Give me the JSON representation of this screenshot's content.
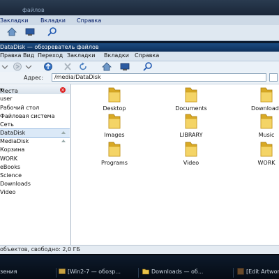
{
  "background_window": {
    "title": "файлов",
    "menu": [
      "Закладки",
      "Вкладки",
      "Справка"
    ]
  },
  "window": {
    "title": "DataDisk — обозреватель файлов",
    "menu": [
      "Правка",
      "Вид",
      "Переход",
      "Закладки",
      "Вкладки",
      "Справка"
    ],
    "address_label": "Адрес:",
    "address_value": "/media/DataDisk"
  },
  "sidebar": {
    "header": "Места",
    "items": [
      {
        "label": "user",
        "selected": false
      },
      {
        "label": "Рабочий стол",
        "selected": false
      },
      {
        "label": "Файловая система",
        "selected": false
      },
      {
        "label": "Сеть",
        "selected": false
      },
      {
        "label": "DataDisk",
        "selected": true
      },
      {
        "label": "MediaDisk",
        "selected": false
      },
      {
        "label": "Корзина",
        "selected": false
      },
      {
        "label": "WORK",
        "selected": false
      },
      {
        "label": "eBooks",
        "selected": false
      },
      {
        "label": "Science",
        "selected": false
      },
      {
        "label": "Downloads",
        "selected": false
      },
      {
        "label": "Video",
        "selected": false
      }
    ]
  },
  "files": [
    {
      "name": "Desktop"
    },
    {
      "name": "Documents"
    },
    {
      "name": "Downloads"
    },
    {
      "name": "Images"
    },
    {
      "name": "LIBRARY"
    },
    {
      "name": "Music"
    },
    {
      "name": "Programs"
    },
    {
      "name": "Video"
    },
    {
      "name": "WORK"
    }
  ],
  "status": "объектов, свободно: 2,0 ГБ",
  "taskbar": {
    "items": [
      {
        "label": "зения"
      },
      {
        "label": "[Win2-7 — обозр..."
      },
      {
        "label": "Downloads — об..."
      },
      {
        "label": "[Edit Artwor"
      }
    ]
  },
  "colors": {
    "title_active": "#1b4b82",
    "folder": "#f0c53a",
    "selection": "#dbe9f7"
  }
}
